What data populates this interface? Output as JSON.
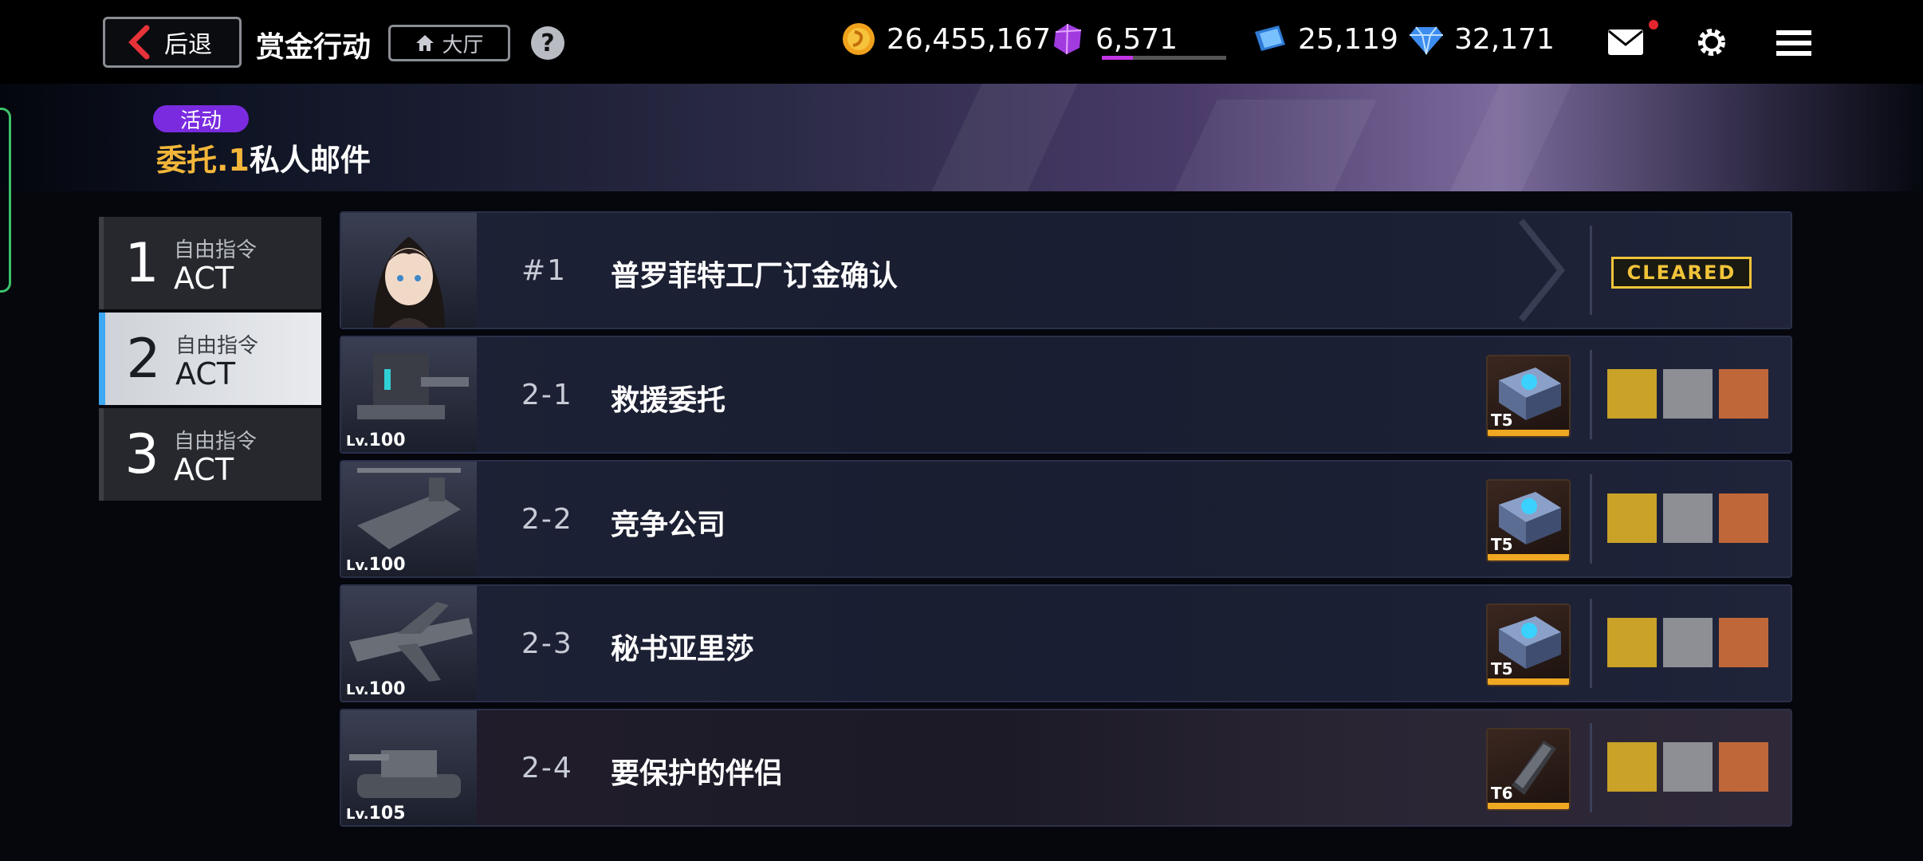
{
  "header": {
    "back_label": "后退",
    "title": "赏金行动",
    "lobby_label": "大厅",
    "help_label": "?"
  },
  "currencies": [
    {
      "name": "coin",
      "value": "26,455,167",
      "icon": "coin-icon"
    },
    {
      "name": "gem",
      "value": "6,571",
      "icon": "purple-gem-icon",
      "bar_fill": 0.25
    },
    {
      "name": "ticket",
      "value": "25,119",
      "icon": "blue-ticket-icon"
    },
    {
      "name": "diamond",
      "value": "32,171",
      "icon": "diamond-icon"
    }
  ],
  "banner": {
    "tag": "活动",
    "title_prefix": "委托.1",
    "title_main": "私人邮件"
  },
  "acts": [
    {
      "num": "1",
      "small": "自由指令",
      "big": "ACT",
      "active": false
    },
    {
      "num": "2",
      "small": "自由指令",
      "big": "ACT",
      "active": true
    },
    {
      "num": "3",
      "small": "自由指令",
      "big": "ACT",
      "active": false
    }
  ],
  "missions": [
    {
      "id": "#1",
      "name": "普罗菲特工厂订金确认",
      "level": "",
      "status": "CLEARED",
      "portrait": "girl-portrait-icon"
    },
    {
      "id": "2-1",
      "name": "救援委托",
      "level": "100",
      "tier": "T5",
      "portrait": "turret-icon"
    },
    {
      "id": "2-2",
      "name": "竞争公司",
      "level": "100",
      "tier": "T5",
      "portrait": "helicopter-icon"
    },
    {
      "id": "2-3",
      "name": "秘书亚里莎",
      "level": "100",
      "tier": "T5",
      "portrait": "aircraft-icon"
    },
    {
      "id": "2-4",
      "name": "要保护的伴侣",
      "level": "105",
      "tier": "T6",
      "portrait": "tank-icon"
    }
  ],
  "lv_prefix": "Lv.",
  "colors": {
    "accent_gold": "#f3b63a",
    "active_blue": "#3ea8f3",
    "event_purple": "#7a2be0"
  }
}
